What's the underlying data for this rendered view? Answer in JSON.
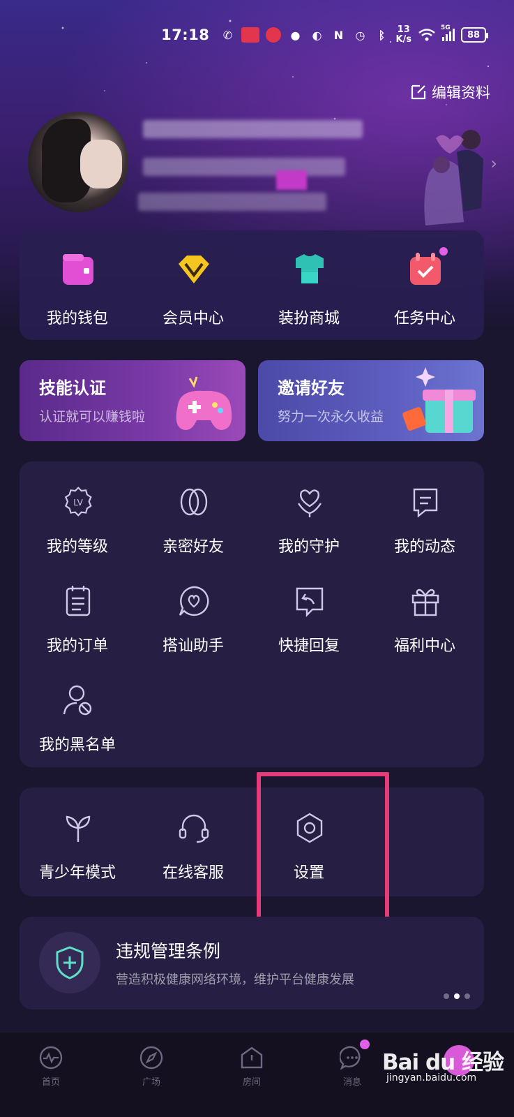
{
  "status_bar": {
    "time": "17:18",
    "net_speed_value": "13",
    "net_speed_unit": "K/s",
    "signal_tag": "5G",
    "battery": "88"
  },
  "profile": {
    "edit_label": "编辑资料"
  },
  "quick_actions": [
    {
      "label": "我的钱包",
      "icon": "wallet-icon"
    },
    {
      "label": "会员中心",
      "icon": "vip-icon"
    },
    {
      "label": "装扮商城",
      "icon": "shirt-icon"
    },
    {
      "label": "任务中心",
      "icon": "calendar-task-icon"
    }
  ],
  "promos": {
    "skill": {
      "title": "技能认证",
      "subtitle": "认证就可以赚钱啦"
    },
    "invite": {
      "title": "邀请好友",
      "subtitle": "努力一次永久收益"
    }
  },
  "menu": [
    {
      "label": "我的等级",
      "icon": "level-icon",
      "badge_text": "LV"
    },
    {
      "label": "亲密好友",
      "icon": "intimate-friends-icon"
    },
    {
      "label": "我的守护",
      "icon": "guard-icon"
    },
    {
      "label": "我的动态",
      "icon": "moments-icon"
    },
    {
      "label": "我的订单",
      "icon": "orders-icon"
    },
    {
      "label": "搭讪助手",
      "icon": "chat-assistant-icon"
    },
    {
      "label": "快捷回复",
      "icon": "quick-reply-icon"
    },
    {
      "label": "福利中心",
      "icon": "gift-icon"
    },
    {
      "label": "我的黑名单",
      "icon": "blacklist-icon"
    }
  ],
  "misc": [
    {
      "label": "青少年模式",
      "icon": "sprout-icon"
    },
    {
      "label": "在线客服",
      "icon": "headset-icon"
    },
    {
      "label": "设置",
      "icon": "settings-icon"
    }
  ],
  "rules_banner": {
    "title": "违规管理条例",
    "subtitle": "营造积极健康网络环境，维护平台健康发展"
  },
  "tabs": [
    {
      "label": "首页",
      "icon": "home-heart-icon"
    },
    {
      "label": "广场",
      "icon": "compass-icon"
    },
    {
      "label": "房间",
      "icon": "room-icon"
    },
    {
      "label": "消息",
      "icon": "message-icon"
    }
  ],
  "watermark": {
    "main": "Bai du 经验",
    "sub": "jingyan.baidu.com"
  },
  "colors": {
    "background": "#1b1630",
    "card": "#261f43",
    "highlight_box": "#e33c79",
    "accent_pink": "#e060e8"
  }
}
